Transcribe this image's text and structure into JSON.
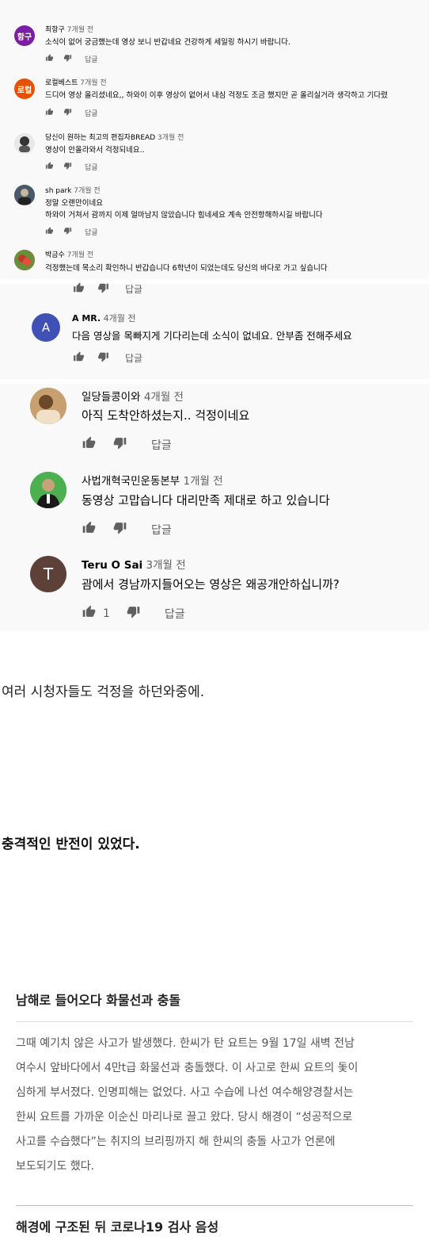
{
  "comments_small": [
    {
      "initial": "항구",
      "avatar_color": "#7b1fa2",
      "author": "최항구",
      "time": "7개월 전",
      "text": "소식이 없어 궁금했는데 영상 보니 반갑네요 건강하게 세일링 하시기 바랍니다.",
      "reply": "답글"
    },
    {
      "initial": "로컬",
      "avatar_color": "#e65100",
      "author": "로컬베스트",
      "time": "7개월 전",
      "text": "드디어 영상 올리셨네요,,   하와이 이후 영상이 없어서 내심 걱정도 조금 했지만 곧 올리실거라 생각하고 기다렸",
      "reply": "답글"
    },
    {
      "initial": "",
      "avatar_color": "#555555",
      "author": "당신이 원하는 최고의 편집자BREAD",
      "time": "3개월 전",
      "text": "영상이 안올라와서 걱정되네요..",
      "reply": "답글"
    },
    {
      "initial": "",
      "avatar_color": "#3a4a5a",
      "author": "sh park",
      "time": "7개월 전",
      "text": "정말 오랜만이네요",
      "text2": "하와이 거쳐서 괌까지 이제 얼마남지 않았습니다 힘네세요 계속 안전항해하시길 바랍니다",
      "reply": "답글"
    },
    {
      "initial": "",
      "avatar_color": "#8a3a3a",
      "author": "박금수",
      "time": "7개월 전",
      "text": "걱정했는데 목소리 확인하니 반갑습니다 6학년이 되었는데도 당신의 바다로 가고 싶습니다",
      "reply": "답글"
    }
  ],
  "comments_mid": [
    {
      "initial": "A",
      "avatar_color": "#3f51b5",
      "author": "A MR.",
      "time": "4개월 전",
      "text": "다음 영상을 목빠지게 기다리는데 소식이 없네요. 안부좀 전해주세요",
      "reply": "답글"
    }
  ],
  "comments_large": [
    {
      "initial": "",
      "avatar_color": "#a07850",
      "author": "일당들콩이와",
      "time": "4개월 전",
      "text": "아직 도착안하셨는지.. 걱정이네요",
      "reply": "답글",
      "likes": ""
    },
    {
      "initial": "",
      "avatar_color": "#2e7d32",
      "author": "사법개혁국민운동본부",
      "time": "1개월 전",
      "text": "동영상 고맙습니다 대리만족 제대로 하고 있습니다",
      "reply": "답글",
      "likes": ""
    },
    {
      "initial": "T",
      "avatar_color": "#5d4037",
      "author": "Teru O Sai",
      "time": "3개월 전",
      "text": "괌에서 경남까지들어오는 영상은 왜공개안하십니까?",
      "reply": "답글",
      "likes": "1"
    }
  ],
  "para1": "여러 시청자들도 걱정을 하던와중에.",
  "para2": "충격적인 반전이 있었다.",
  "article": {
    "heading1": "남해로 들어오다 화물선과 충돌",
    "lines": [
      "그때 예기치 않은 사고가 발생했다. 한씨가 탄 요트는 9월 17일 새벽 전남",
      "여수시 앞바다에서 4만t급 화물선과 충돌했다. 이 사고로 한씨 요트의 돛이",
      "심하게 부서졌다. 인명피해는 없었다. 사고 수습에 나선 여수해양경찰서는",
      "한씨 요트를 가까운 이순신 마리나로 끌고 왔다. 당시 해경이 “성공적으로",
      "사고를 수습했다”는 취지의 브리핑까지 해 한씨의 충돌 사고가 언론에",
      "보도되기도 했다."
    ],
    "heading2": "해경에 구조된 뒤 코로나19 검사 음성"
  },
  "icons": {
    "like": "thumb-up-icon",
    "dislike": "thumb-down-icon"
  }
}
